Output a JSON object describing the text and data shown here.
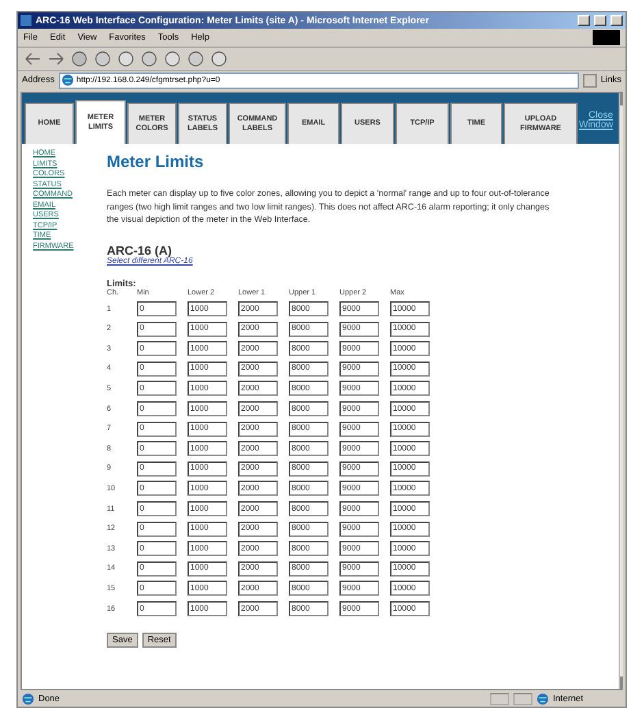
{
  "window": {
    "title": "ARC-16 Web Interface Configuration: Meter Limits (site A) - Microsoft Internet Explorer"
  },
  "menu": [
    "File",
    "Edit",
    "View",
    "Favorites",
    "Tools",
    "Help"
  ],
  "address": {
    "label": "Address",
    "value": "http://192.168.0.249/cfgmtrset.php?u=0",
    "links": "Links"
  },
  "tabs": [
    {
      "label": "HOME",
      "selected": false
    },
    {
      "label": "METER\nLIMITS",
      "selected": true
    },
    {
      "label": "METER\nCOLORS",
      "selected": false
    },
    {
      "label": "STATUS\nLABELS",
      "selected": false
    },
    {
      "label": "COMMAND\nLABELS",
      "selected": false
    },
    {
      "label": "EMAIL",
      "selected": false
    },
    {
      "label": "USERS",
      "selected": false
    },
    {
      "label": "TCP/IP",
      "selected": false
    },
    {
      "label": "TIME",
      "selected": false
    },
    {
      "label": "UPLOAD\nFIRMWARE",
      "selected": false
    }
  ],
  "close_link": "Close\nWindow",
  "sidebar": [
    "HOME",
    "LIMITS",
    "COLORS",
    "STATUS",
    "COMMAND",
    "EMAIL",
    "USERS",
    "TCP/IP",
    "TIME",
    "FIRMWARE"
  ],
  "heading": "Meter Limits",
  "description": "Each meter can display up to five color zones, allowing you to depict a 'normal' range and up to four out-of-tolerance ranges (two high limit ranges and two low limit ranges). This does not affect ARC-16 alarm reporting; it only changes the visual depiction of the meter in the Web Interface.",
  "device": "ARC-16 (A)",
  "select_link": "Select different ARC-16",
  "limits_label": "Limits:",
  "columns": [
    "Ch.",
    "Min",
    "Lower 2",
    "Lower 1",
    "Upper 1",
    "Upper 2",
    "Max"
  ],
  "rows": [
    {
      "ch": "1",
      "values": [
        "0",
        "1000",
        "2000",
        "8000",
        "9000",
        "10000"
      ]
    },
    {
      "ch": "2",
      "values": [
        "0",
        "1000",
        "2000",
        "8000",
        "9000",
        "10000"
      ]
    },
    {
      "ch": "3",
      "values": [
        "0",
        "1000",
        "2000",
        "8000",
        "9000",
        "10000"
      ]
    },
    {
      "ch": "4",
      "values": [
        "0",
        "1000",
        "2000",
        "8000",
        "9000",
        "10000"
      ]
    },
    {
      "ch": "5",
      "values": [
        "0",
        "1000",
        "2000",
        "8000",
        "9000",
        "10000"
      ]
    },
    {
      "ch": "6",
      "values": [
        "0",
        "1000",
        "2000",
        "8000",
        "9000",
        "10000"
      ]
    },
    {
      "ch": "7",
      "values": [
        "0",
        "1000",
        "2000",
        "8000",
        "9000",
        "10000"
      ]
    },
    {
      "ch": "8",
      "values": [
        "0",
        "1000",
        "2000",
        "8000",
        "9000",
        "10000"
      ]
    },
    {
      "ch": "9",
      "values": [
        "0",
        "1000",
        "2000",
        "8000",
        "9000",
        "10000"
      ]
    },
    {
      "ch": "10",
      "values": [
        "0",
        "1000",
        "2000",
        "8000",
        "9000",
        "10000"
      ]
    },
    {
      "ch": "11",
      "values": [
        "0",
        "1000",
        "2000",
        "8000",
        "9000",
        "10000"
      ]
    },
    {
      "ch": "12",
      "values": [
        "0",
        "1000",
        "2000",
        "8000",
        "9000",
        "10000"
      ]
    },
    {
      "ch": "13",
      "values": [
        "0",
        "1000",
        "2000",
        "8000",
        "9000",
        "10000"
      ]
    },
    {
      "ch": "14",
      "values": [
        "0",
        "1000",
        "2000",
        "8000",
        "9000",
        "10000"
      ]
    },
    {
      "ch": "15",
      "values": [
        "0",
        "1000",
        "2000",
        "8000",
        "9000",
        "10000"
      ]
    },
    {
      "ch": "16",
      "values": [
        "0",
        "1000",
        "2000",
        "8000",
        "9000",
        "10000"
      ]
    }
  ],
  "buttons": [
    "Save",
    "Reset"
  ],
  "status_bar": {
    "left": "Done",
    "zone": "Internet"
  }
}
